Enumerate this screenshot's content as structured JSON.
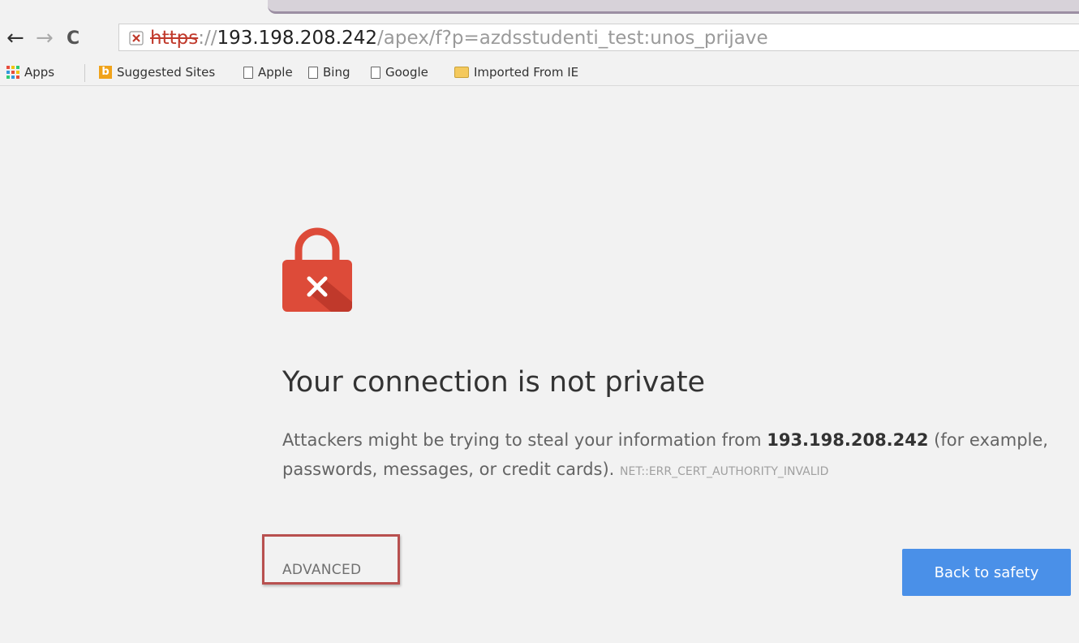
{
  "browser": {
    "url": {
      "scheme": "https",
      "rest_prefix": "://",
      "host": "193.198.208.242",
      "path": "/apex/f?p=azdsstudenti_test:unos_prijave"
    },
    "nav": {
      "back_glyph": "←",
      "forward_glyph": "→",
      "reload_glyph": "C"
    },
    "bookmarks": [
      {
        "label": "Apps",
        "icon": "apps-grid-icon"
      },
      {
        "label": "Suggested Sites",
        "icon": "bing-icon"
      },
      {
        "label": "Apple",
        "icon": "page-icon"
      },
      {
        "label": "Bing",
        "icon": "page-icon"
      },
      {
        "label": "Google",
        "icon": "page-icon"
      },
      {
        "label": "Imported From IE",
        "icon": "folder-icon"
      }
    ]
  },
  "interstitial": {
    "heading": "Your connection is not private",
    "desc_prefix": "Attackers might be trying to steal your information from ",
    "host": "193.198.208.242",
    "desc_suffix": " (for example, passwords, messages, or credit cards).",
    "error_code": "NET::ERR_CERT_AUTHORITY_INVALID",
    "advanced_label": "ADVANCED",
    "back_button_label": "Back to safety",
    "colors": {
      "danger": "#dd4b39",
      "primary": "#4a90e8",
      "highlight": "#b8504f"
    }
  }
}
